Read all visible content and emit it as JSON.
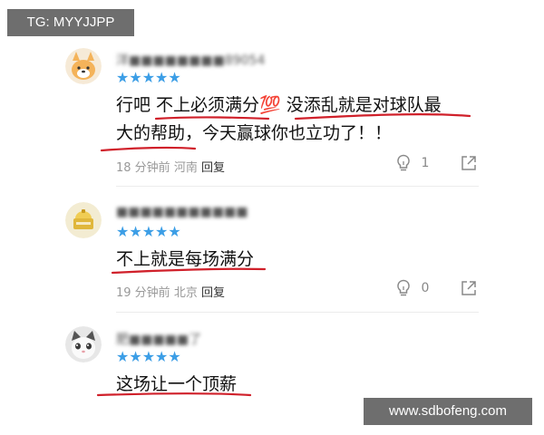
{
  "watermarks": {
    "top": "TG: MYYJJPP",
    "bottom": "www.sdbofeng.com"
  },
  "comments": [
    {
      "username": "洋■■■■■■■■89054",
      "rating": "★★★★★",
      "text_line1": "行吧 不上必须满分💯 没添乱就是对球队最",
      "text_line2": "大的帮助，今天赢球你也立功了！！",
      "time": "18 分钟前",
      "location": "河南",
      "reply_label": "回复",
      "likes": "1",
      "avatar_icon": "dog-avatar-icon"
    },
    {
      "username": "■■■■■■■■■■■",
      "rating": "★★★★★",
      "text_line1": "不上就是每场满分",
      "time": "19 分钟前",
      "location": "北京",
      "reply_label": "回复",
      "likes": "0",
      "avatar_icon": "bell-avatar-icon"
    },
    {
      "username": "肥■■■■■了",
      "rating": "★★★★★",
      "text_line1": "这场让一个顶薪",
      "avatar_icon": "cat-avatar-icon"
    }
  ],
  "colors": {
    "star": "#3c9ee6",
    "underline": "#d0202a",
    "meta": "#999999"
  }
}
